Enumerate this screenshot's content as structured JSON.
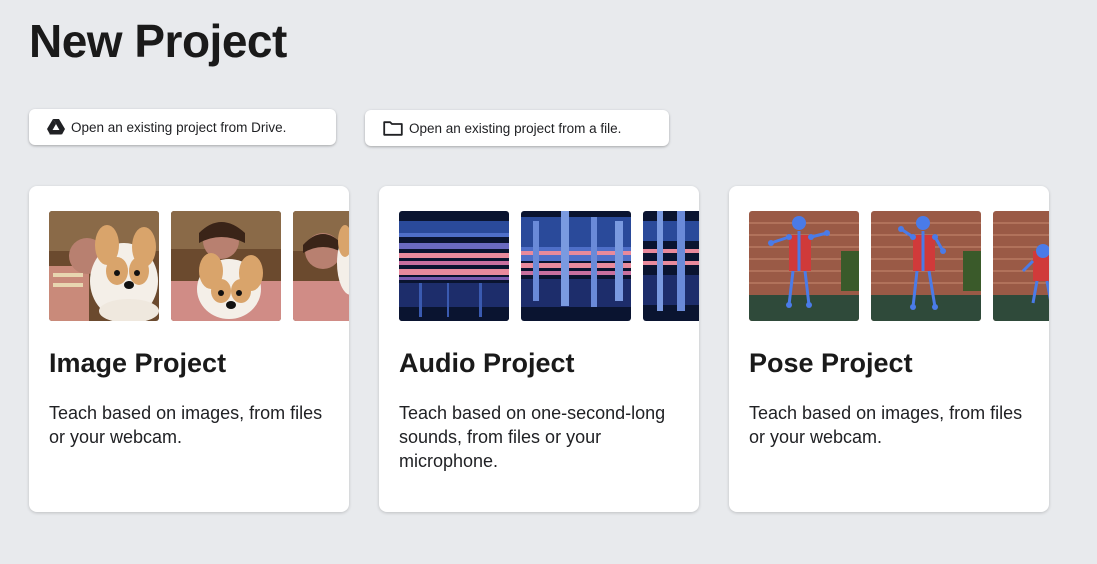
{
  "page": {
    "title": "New Project"
  },
  "actions": {
    "drive_label": "Open an existing project from Drive.",
    "file_label": "Open an existing project from a file."
  },
  "icons": {
    "drive": "google-drive-icon",
    "file": "folder-icon"
  },
  "cards": [
    {
      "title": "Image Project",
      "description": "Teach based on images, from files or your webcam."
    },
    {
      "title": "Audio Project",
      "description": "Teach based on one-second-long sounds, from files or your microphone."
    },
    {
      "title": "Pose Project",
      "description": "Teach based on images, from files or your webcam."
    }
  ],
  "colors": {
    "background": "#e8eaed",
    "card": "#ffffff",
    "text": "#202124",
    "spectrogram_dark": "#1d2d6b",
    "spectrogram_hot": "#e98a9c",
    "pose_skeleton": "#4a7be8"
  }
}
